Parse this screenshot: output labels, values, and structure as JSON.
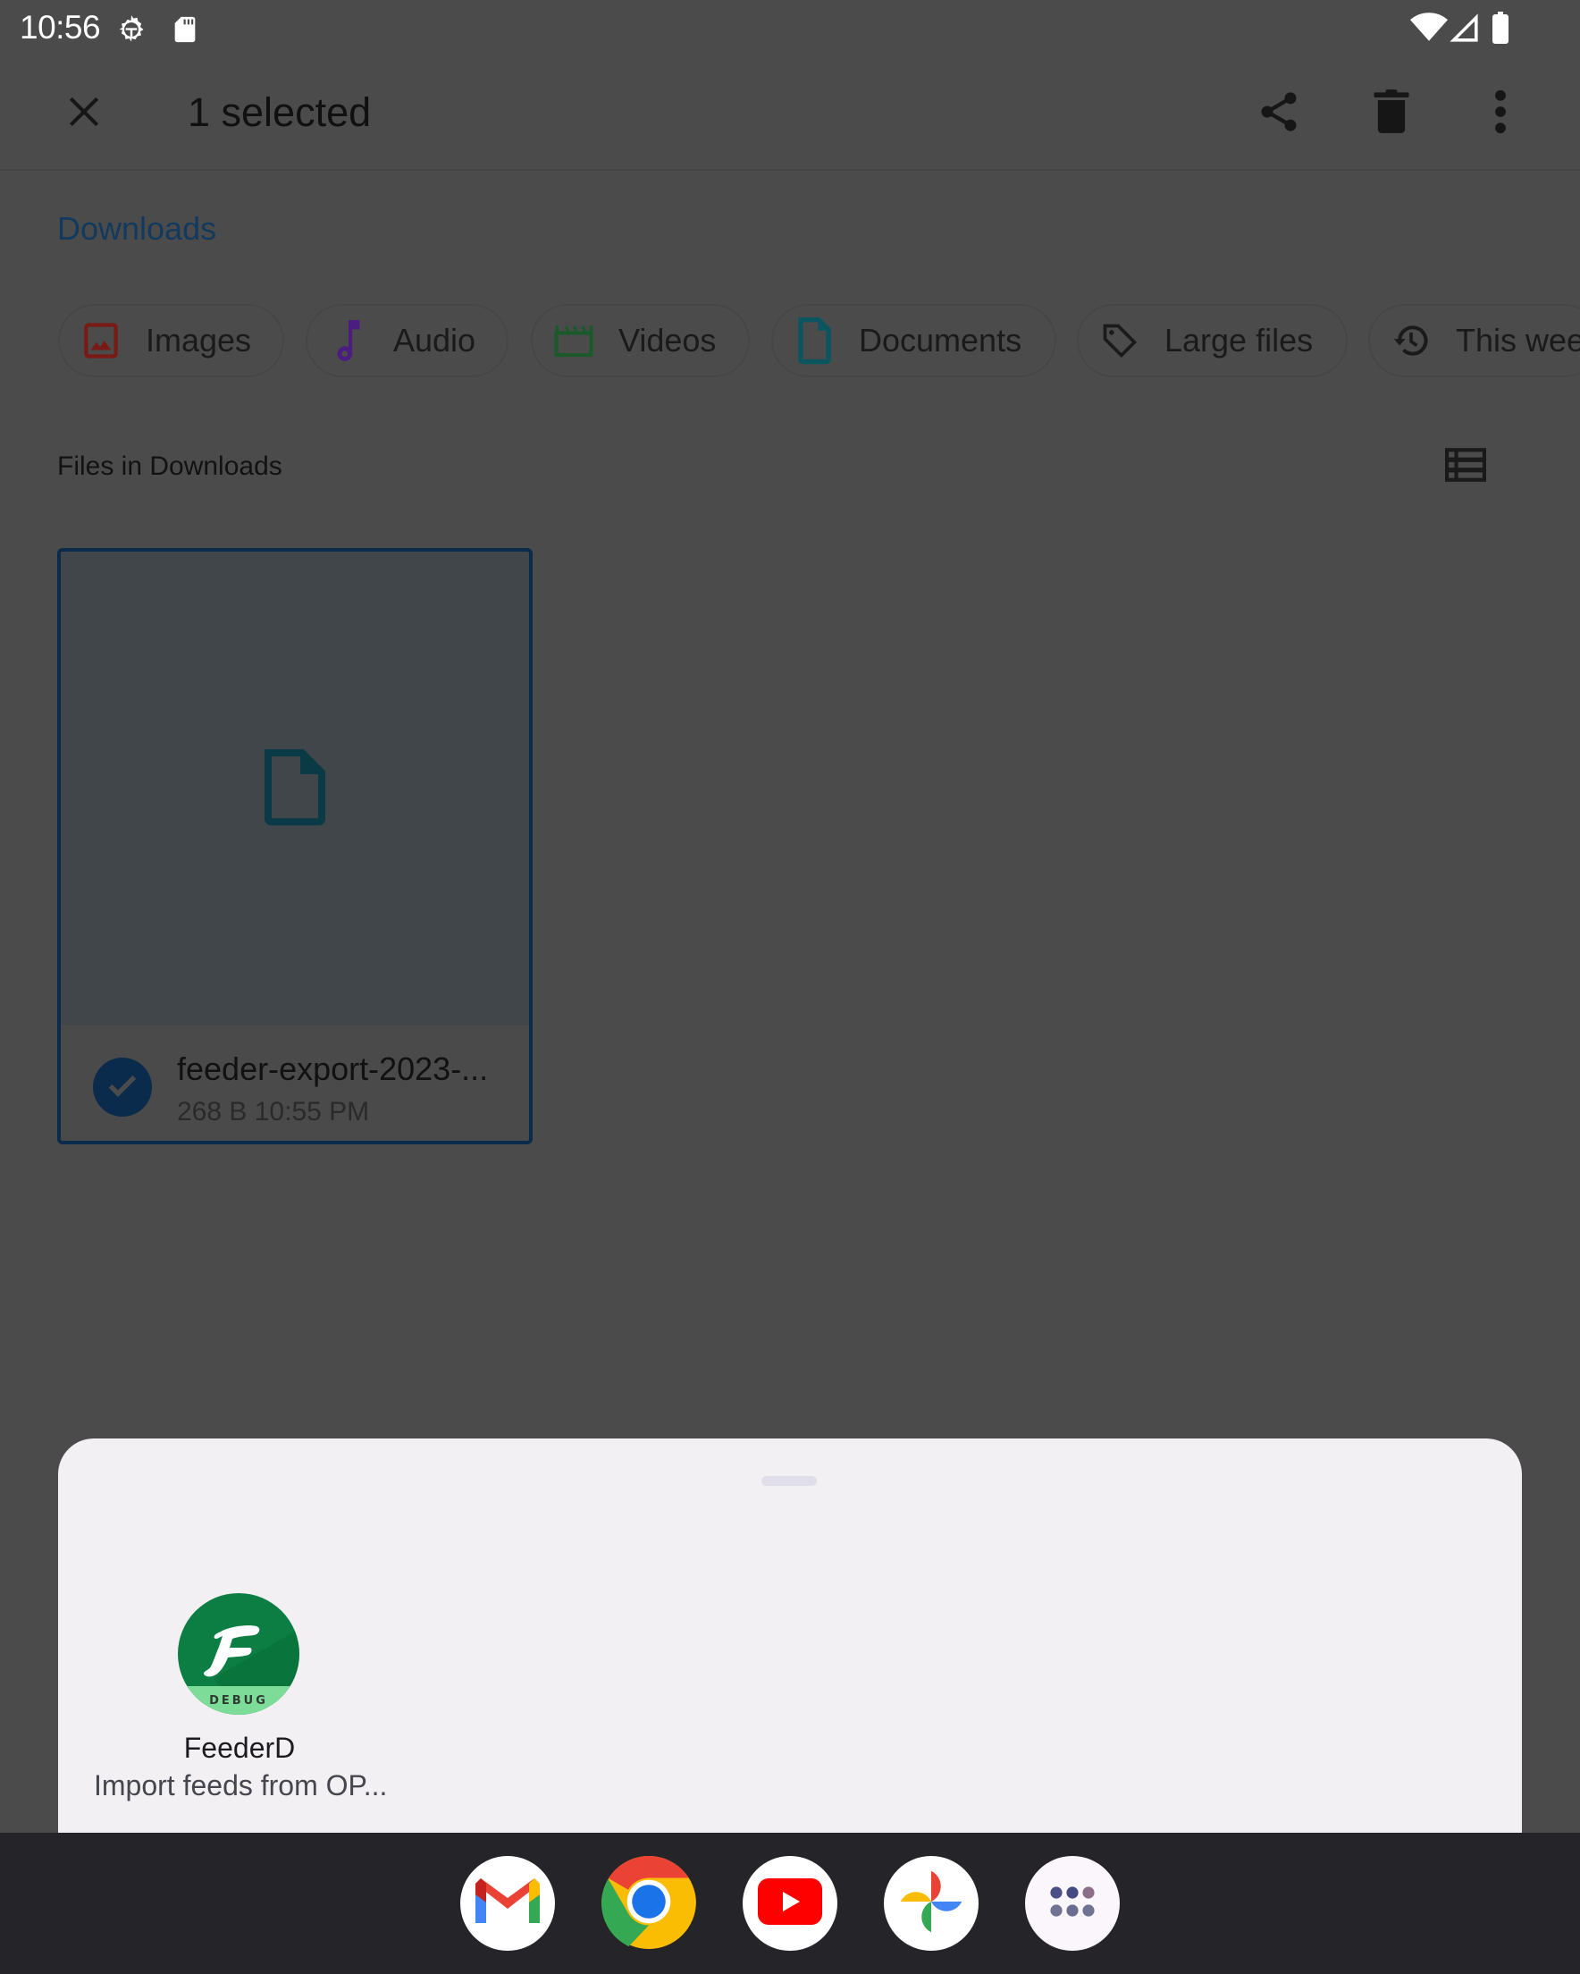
{
  "status_bar": {
    "time": "10:56",
    "left_icons": [
      "debug-gear-icon",
      "sd-card-icon"
    ],
    "right_icons": [
      "wifi-icon",
      "cell-signal-icon",
      "battery-icon"
    ]
  },
  "app_bar": {
    "close_icon": "close-icon",
    "title": "1 selected",
    "actions": [
      {
        "name": "share",
        "icon": "share-icon"
      },
      {
        "name": "delete",
        "icon": "trash-icon"
      },
      {
        "name": "more",
        "icon": "more-vert-icon"
      }
    ]
  },
  "breadcrumb": "Downloads",
  "chips": [
    {
      "label": "Images",
      "icon": "image-icon",
      "color": "#7a1a14"
    },
    {
      "label": "Audio",
      "icon": "music-note-icon",
      "color": "#4b1d80"
    },
    {
      "label": "Videos",
      "icon": "clapperboard-icon",
      "color": "#1a5a2a"
    },
    {
      "label": "Documents",
      "icon": "document-icon",
      "color": "#0b5560"
    },
    {
      "label": "Large files",
      "icon": "tag-icon",
      "color": "#1a1a1a"
    },
    {
      "label": "This week",
      "icon": "history-icon",
      "color": "#1a1a1a"
    }
  ],
  "section": {
    "title": "Files in Downloads",
    "view_toggle_icon": "list-view-icon"
  },
  "files": [
    {
      "name": "feeder-export-2023-...",
      "size": "268 B",
      "time": "10:55 PM",
      "meta": "268 B 10:55 PM",
      "selected": true,
      "icon": "document-icon"
    }
  ],
  "share_sheet": {
    "targets": [
      {
        "app_name": "FeederD",
        "description": "Import feeds from OP...",
        "badge": "DEBUG",
        "icon_letter": "F"
      }
    ]
  },
  "taskbar": {
    "apps": [
      {
        "name": "Gmail",
        "icon": "gmail-icon"
      },
      {
        "name": "Chrome",
        "icon": "chrome-icon"
      },
      {
        "name": "YouTube",
        "icon": "youtube-icon"
      },
      {
        "name": "Photos",
        "icon": "photos-icon"
      },
      {
        "name": "All apps",
        "icon": "app-drawer-icon"
      }
    ]
  },
  "colors": {
    "scrim": "#4b4b4b",
    "selection": "#0b2b4c",
    "sheet_bg": "#f2f0f3",
    "taskbar_bg": "#242429",
    "feeder_green": "#0c7e43",
    "debug_band": "#7ddc97"
  }
}
